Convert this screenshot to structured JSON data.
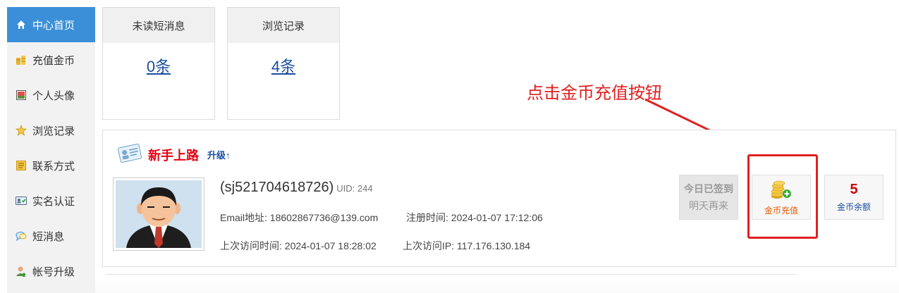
{
  "sidebar": {
    "items": [
      {
        "label": "中心首页",
        "icon": "home-icon",
        "active": true
      },
      {
        "label": "充值金币",
        "icon": "coins-icon",
        "active": false
      },
      {
        "label": "个人头像",
        "icon": "picture-icon",
        "active": false
      },
      {
        "label": "浏览记录",
        "icon": "star-icon",
        "active": false
      },
      {
        "label": "联系方式",
        "icon": "contact-card-icon",
        "active": false
      },
      {
        "label": "实名认证",
        "icon": "id-card-icon",
        "active": false
      },
      {
        "label": "短消息",
        "icon": "chat-bubble-icon",
        "active": false
      },
      {
        "label": "帐号升级",
        "icon": "user-upgrade-icon",
        "active": false
      }
    ]
  },
  "stats": {
    "unread": {
      "title": "未读短消息",
      "value": "0条"
    },
    "history": {
      "title": "浏览记录",
      "value": "4条"
    }
  },
  "profile": {
    "level_title": "新手上路",
    "upgrade_label": "升级↑",
    "username": "(sj521704618726)",
    "uid": "UID: 244",
    "email": "Email地址: 18602867736@139.com",
    "register_time": "注册时间: 2024-01-07 17:12:06",
    "last_visit_time": "上次访问时间: 2024-01-07 18:28:02",
    "last_visit_ip": "上次访问IP: 117.176.130.184"
  },
  "actions": {
    "signin_line1": "今日已签到",
    "signin_line2": "明天再来",
    "recharge_label": "金币充值",
    "balance_value": "5",
    "balance_label": "金币余额"
  },
  "annotation": {
    "text": "点击金币充值按钮"
  },
  "colors": {
    "accent": "#3b8fd9",
    "annotation_red": "#e02020",
    "link_blue": "#1a4fa0"
  }
}
